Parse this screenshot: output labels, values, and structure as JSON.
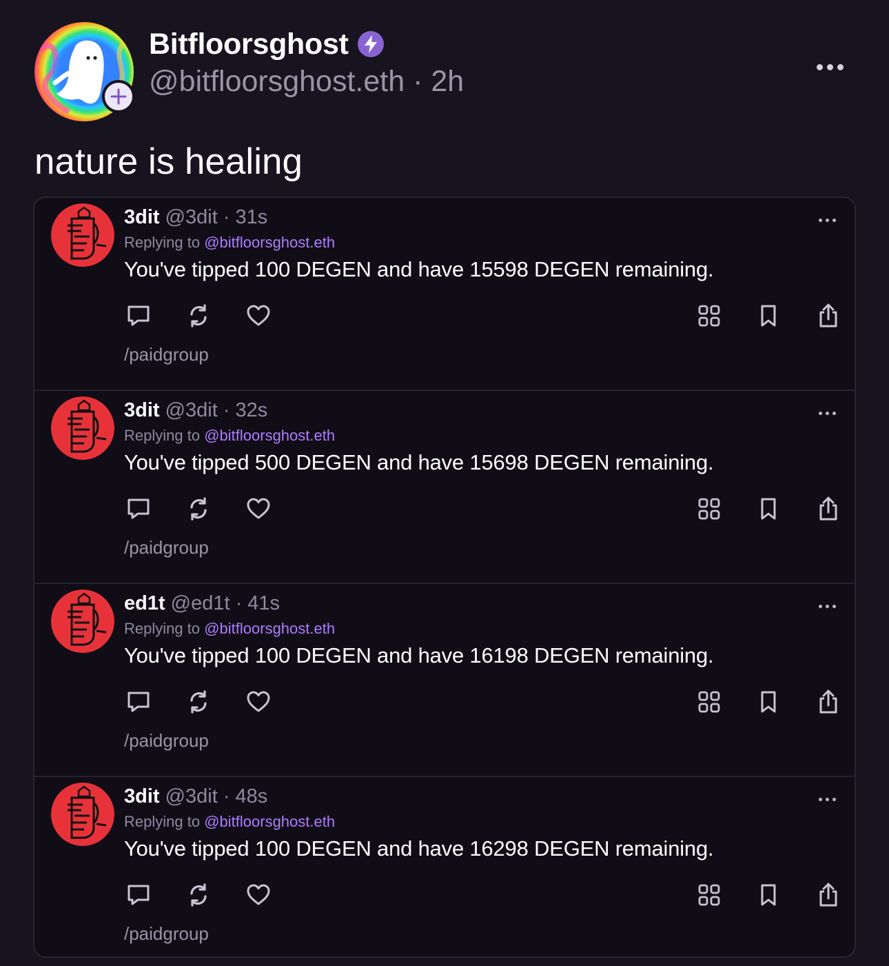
{
  "post": {
    "author_name": "Bitfloorsghost",
    "author_meta": "@bitfloorsghost.eth · 2h",
    "text": "nature is healing"
  },
  "replies": [
    {
      "name": "3dit",
      "meta": "@3dit · 31s",
      "replying_prefix": "Replying to",
      "replying_handle": "@bitfloorsghost.eth",
      "text": "You've tipped 100 DEGEN and have 15598 DEGEN remaining.",
      "channel": "/paidgroup"
    },
    {
      "name": "3dit",
      "meta": "@3dit · 32s",
      "replying_prefix": "Replying to",
      "replying_handle": "@bitfloorsghost.eth",
      "text": "You've tipped 500 DEGEN and have 15698 DEGEN remaining.",
      "channel": "/paidgroup"
    },
    {
      "name": "ed1t",
      "meta": "@ed1t · 41s",
      "replying_prefix": "Replying to",
      "replying_handle": "@bitfloorsghost.eth",
      "text": "You've tipped 100 DEGEN and have 16198 DEGEN remaining.",
      "channel": "/paidgroup"
    },
    {
      "name": "3dit",
      "meta": "@3dit · 48s",
      "replying_prefix": "Replying to",
      "replying_handle": "@bitfloorsghost.eth",
      "text": "You've tipped 100 DEGEN and have 16298 DEGEN remaining.",
      "channel": "/paidgroup"
    }
  ],
  "icons": {
    "reply": "comment-icon",
    "recast": "recast-icon",
    "like": "heart-icon",
    "apps": "grid-icon",
    "bookmark": "bookmark-icon",
    "share": "share-icon"
  },
  "colors": {
    "background": "#17131f",
    "card_background": "#100d17",
    "mention": "#b07cff",
    "power_badge": "#8a63d2",
    "avatar_red": "#e8323a"
  }
}
